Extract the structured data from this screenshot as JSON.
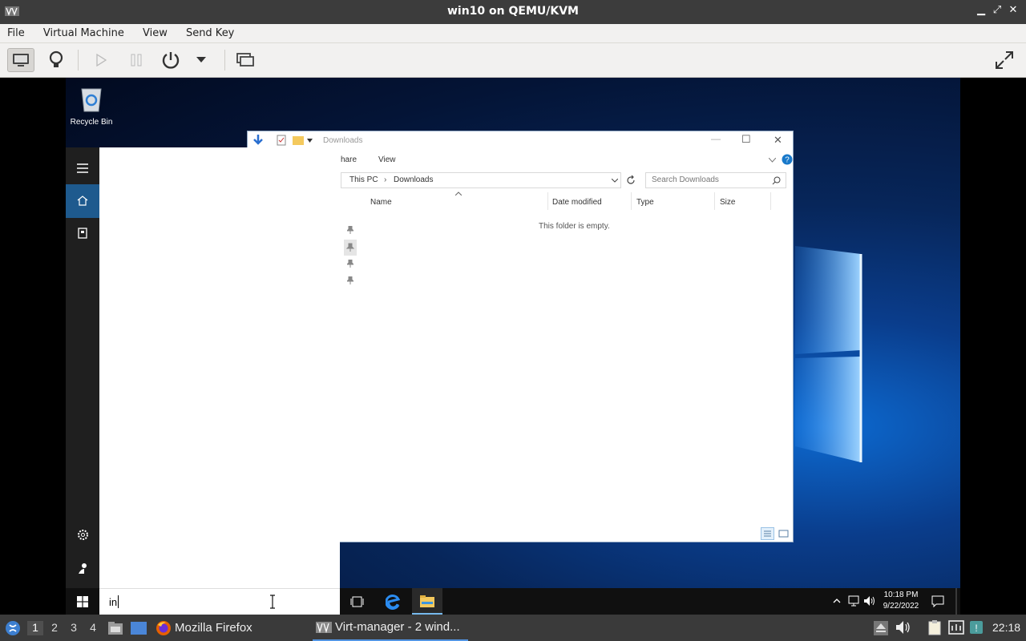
{
  "window": {
    "title": "win10 on QEMU/KVM",
    "controls": {
      "minimize": "▁",
      "maximize": "⤢",
      "close": "✕"
    }
  },
  "menu": [
    "File",
    "Virtual Machine",
    "View",
    "Send Key"
  ],
  "toolbar": {
    "icons": [
      "monitor-icon",
      "lightbulb-icon",
      "play-icon",
      "pause-icon",
      "power-icon",
      "dropdown-icon",
      "snapshots-icon",
      "fullscreen-icon"
    ]
  },
  "guest": {
    "desktop": {
      "recycle_bin_label": "Recycle Bin"
    },
    "explorer": {
      "title": "Downloads",
      "ribbon_tabs": [
        "hare",
        "View"
      ],
      "breadcrumb": [
        "This PC",
        "Downloads"
      ],
      "search_placeholder": "Search Downloads",
      "columns": [
        "Name",
        "Date modified",
        "Type",
        "Size"
      ],
      "empty_message": "This folder is empty.",
      "window_controls": {
        "minimize": "—",
        "maximize": "☐",
        "close": "✕"
      }
    },
    "start": {
      "search_text": "in"
    },
    "taskbar": {
      "time": "10:18 PM",
      "date": "9/22/2022"
    }
  },
  "host_taskbar": {
    "workspaces": [
      "1",
      "2",
      "3",
      "4"
    ],
    "current_workspace": "1",
    "tasks": [
      {
        "label": "Mozilla Firefox",
        "icon": "firefox-icon",
        "active": false
      },
      {
        "label": "Virt-manager - 2 wind...",
        "icon": "virt-manager-icon",
        "active": true
      }
    ],
    "clock": "22:18"
  },
  "colors": {
    "host_titlebar": "#3c3c3c",
    "toolbar_bg": "#f2f1f0",
    "start_rail": "#1f1f1f",
    "start_home_accent": "#1e5a8e",
    "win_taskbar": "#101010",
    "host_taskbar": "#3a3a3a",
    "active_task_underline": "#5294e2"
  }
}
